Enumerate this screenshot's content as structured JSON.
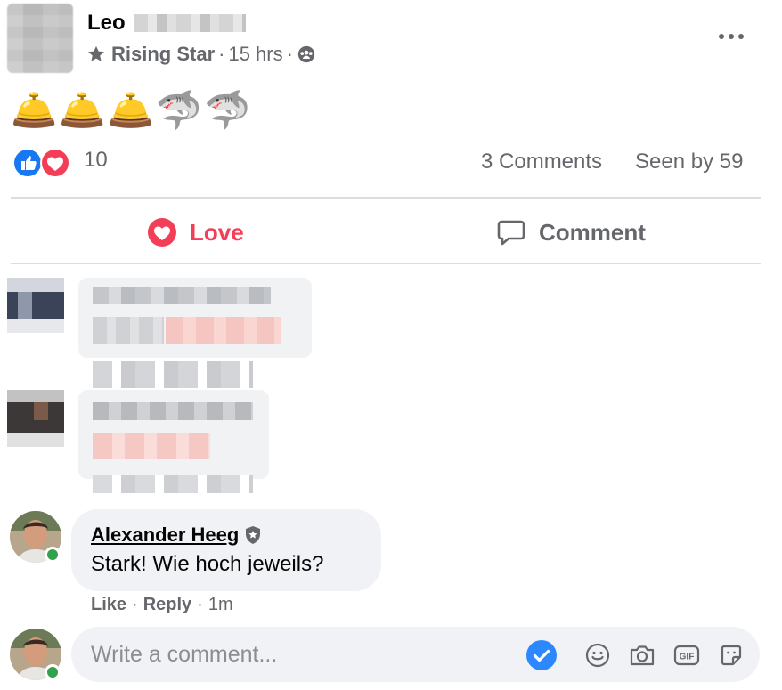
{
  "post": {
    "author_name": "Leo",
    "badge_label": "Rising Star",
    "time": "15 hrs",
    "audience_icon": "groups-icon",
    "text": "🛎️🛎️🛎️🦈🦈",
    "reactions_count": "10",
    "comments_count": "3 Comments",
    "seen_count": "Seen by 59"
  },
  "actions": {
    "love_label": "Love",
    "comment_label": "Comment"
  },
  "comment": {
    "author": "Alexander Heeg",
    "text": "Stark! Wie hoch jeweils?",
    "like_label": "Like",
    "reply_label": "Reply",
    "time": "1m"
  },
  "composer": {
    "placeholder": "Write a comment..."
  },
  "colors": {
    "love": "#f33e58",
    "like_blue": "#1877f2",
    "online": "#31a24c",
    "muted": "#65676b"
  }
}
